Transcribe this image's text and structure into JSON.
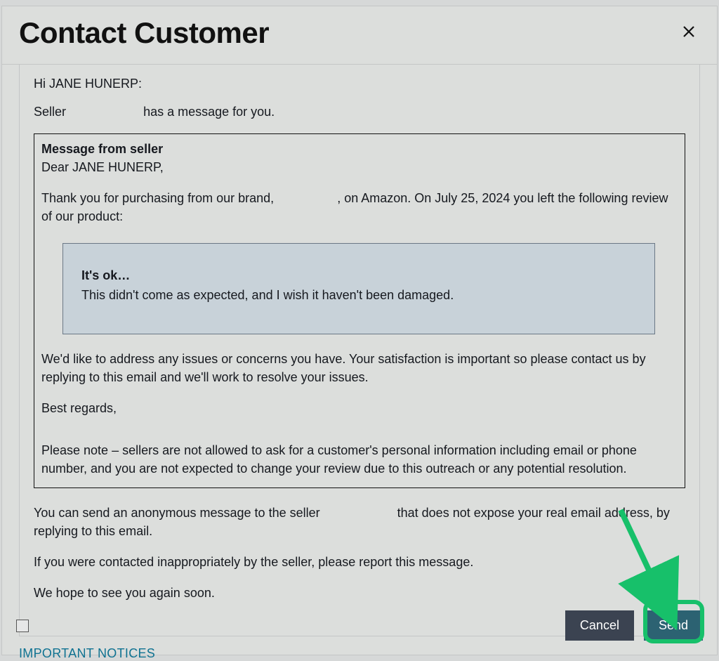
{
  "header": {
    "title": "Contact Customer"
  },
  "preview": {
    "greeting_prefix": "Hi ",
    "customer_name": "JANE HUNERP",
    "greeting_suffix": ":",
    "intro_before": "Seller",
    "intro_after": "has a message for you.",
    "message": {
      "frame_title": "Message from seller",
      "salutation": "Dear JANE HUNERP,",
      "body_1_before": "Thank you for purchasing from our brand,",
      "body_1_after": ", on Amazon. On July 25, 2024 you left the following review of our product:",
      "review": {
        "title": "It's ok…",
        "body": "This didn't come as expected, and I wish it haven't been damaged."
      },
      "body_2": "We'd like to address any issues or concerns you have. Your satisfaction is important so please contact us by replying to this email and we'll work to resolve your issues.",
      "signoff": "Best regards,",
      "note": "Please note – sellers are not allowed to ask for a customer's personal information including email or phone number, and you are not expected to change your review due to this outreach or any potential resolution."
    },
    "footer_1_before": "You can send an anonymous message to the seller",
    "footer_1_after": "that does not expose your real email address, by replying to this email.",
    "footer_2": "If you were contacted inappropriately by the seller, please report this message.",
    "footer_3": "We hope to see you again soon."
  },
  "notices_link": "IMPORTANT NOTICES",
  "buttons": {
    "cancel": "Cancel",
    "send": "Send"
  }
}
